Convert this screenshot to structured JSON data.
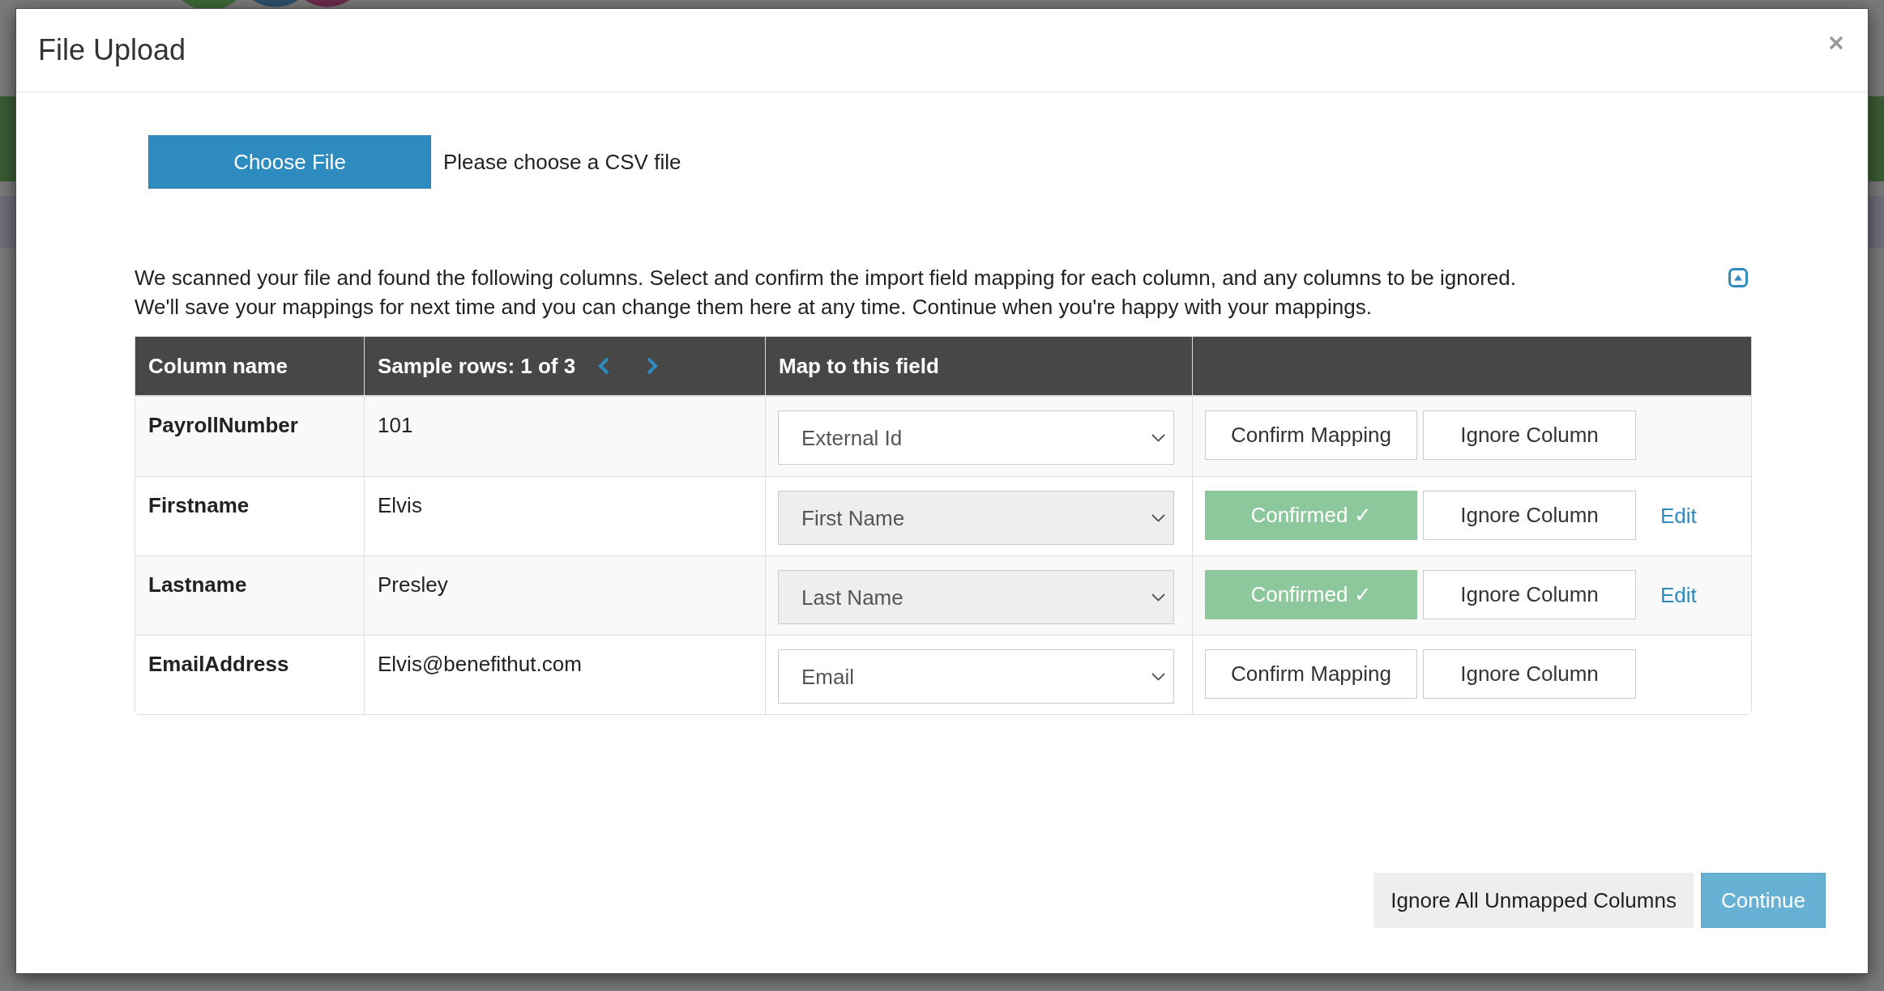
{
  "dialog": {
    "title": "File Upload",
    "file_picker": {
      "button": "Choose File",
      "status": "Please choose a CSV file"
    },
    "instructions": {
      "expanded": true,
      "lines": [
        "We scanned your file and found the following columns. Select and confirm the import field mapping for each column, and any columns to be ignored.",
        "We'll save your mappings for next time and you can change them here at any time. Continue when you're happy with your mappings."
      ]
    },
    "mapping_table": {
      "columns": [
        {
          "label": "Column name",
          "kind": "text"
        },
        {
          "label": "Sample rows: 1 of 3",
          "kind": "pager"
        },
        {
          "label": "Map to this field",
          "kind": "text"
        }
      ],
      "rows": [
        {
          "column_name": "PayrollNumber",
          "sample": "101",
          "field": "External Id",
          "confirmed": false,
          "confirm_button": "Confirm Mapping",
          "ignore_button": "Ignore Column"
        },
        {
          "column_name": "Firstname",
          "sample": "Elvis",
          "field": "First Name",
          "confirmed": true,
          "confirm_button": "Confirmed ✓",
          "ignore_button": "Ignore Column",
          "edit_link": "Edit"
        },
        {
          "column_name": "Lastname",
          "sample": "Presley",
          "field": "Last Name",
          "confirmed": true,
          "confirm_button": "Confirmed ✓",
          "ignore_button": "Ignore Column",
          "edit_link": "Edit"
        },
        {
          "column_name": "EmailAddress",
          "sample": "Elvis@benefithut.com",
          "field": "Email",
          "confirmed": false,
          "confirm_button": "Confirm Mapping",
          "ignore_button": "Ignore Column"
        }
      ]
    },
    "footer_buttons": [
      {
        "label": "Ignore All Unmapped Columns",
        "kind": "secondary"
      },
      {
        "label": "Continue",
        "kind": "primary"
      }
    ]
  }
}
